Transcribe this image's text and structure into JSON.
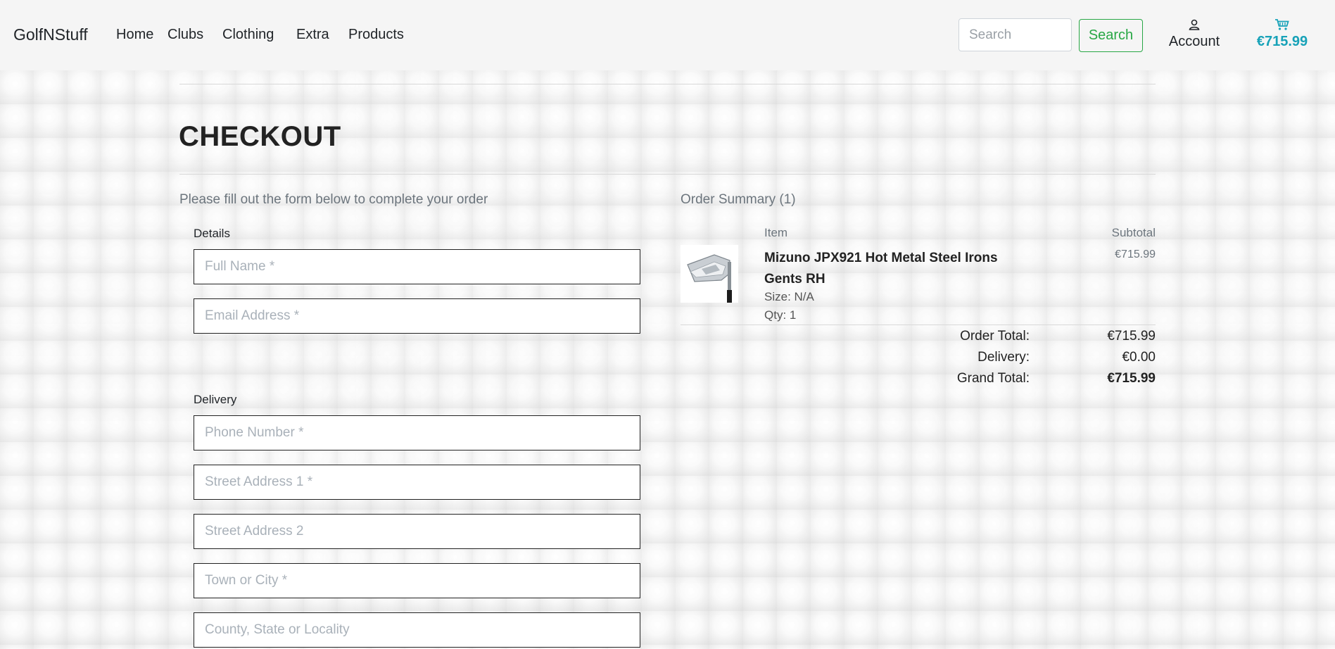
{
  "navbar": {
    "brand": "GolfNStuff",
    "links": [
      "Home",
      "Clubs",
      "Clothing",
      "Extra",
      "Products"
    ],
    "search_placeholder": "Search",
    "search_button": "Search",
    "account_label": "Account",
    "cart_total": "€715.99",
    "icons": {
      "account": "person-icon",
      "cart": "cart-icon"
    },
    "colors": {
      "search": "#28a745",
      "cart": "#17a2b8"
    }
  },
  "page": {
    "title": "CHECKOUT",
    "form_intro": "Please fill out the form below to complete your order"
  },
  "form": {
    "details_legend": "Details",
    "delivery_legend": "Delivery",
    "fields": {
      "full_name": "Full Name *",
      "email": "Email Address *",
      "phone": "Phone Number *",
      "street1": "Street Address 1 *",
      "street2": "Street Address 2",
      "town": "Town or City *",
      "county": "County, State or Locality"
    }
  },
  "summary": {
    "title": "Order Summary (1)",
    "item_header": "Item",
    "subtotal_header": "Subtotal",
    "item": {
      "name": "Mizuno JPX921 Hot Metal Steel Irons Gents RH",
      "size": "Size: N/A",
      "qty": "Qty: 1",
      "subtotal": "€715.99"
    },
    "order_total_label": "Order Total:",
    "order_total": "€715.99",
    "delivery_label": "Delivery:",
    "delivery": "€0.00",
    "grand_total_label": "Grand Total:",
    "grand_total": "€715.99"
  }
}
